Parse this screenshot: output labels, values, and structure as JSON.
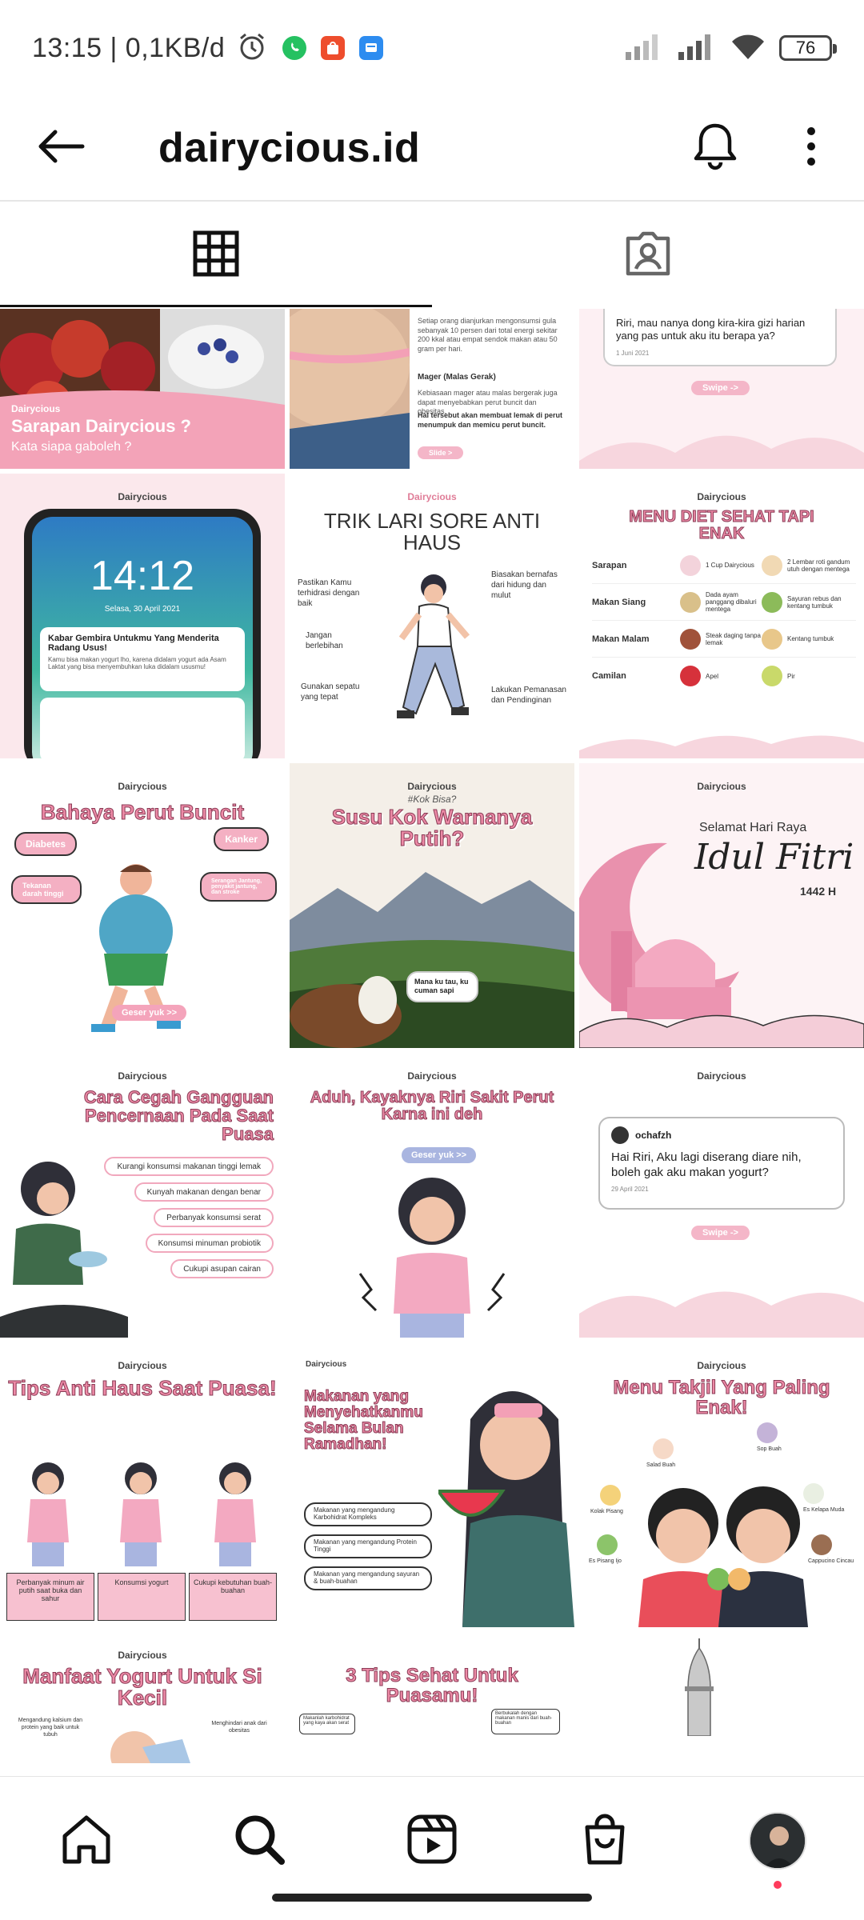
{
  "status_bar": {
    "time_speed": "13:15 | 0,1KB/d",
    "battery": "76",
    "icons": [
      "alarm-icon",
      "whatsapp-icon",
      "shopee-icon",
      "message-icon",
      "signal-icon",
      "signal-icon",
      "wifi-icon",
      "battery-icon"
    ]
  },
  "header": {
    "title": "dairycious.id",
    "icons": [
      "back-arrow-icon",
      "bell-icon",
      "more-vertical-icon"
    ]
  },
  "tabs": [
    {
      "name": "grid",
      "icon": "grid-icon",
      "active": true
    },
    {
      "name": "tagged",
      "icon": "tagged-person-icon",
      "active": false
    }
  ],
  "posts": {
    "p1": {
      "brand": "Dairycious",
      "title": "Sarapan Dairycious ?",
      "subtitle": "Kata siapa gaboleh ?"
    },
    "p2": {
      "text1": "Setiap orang dianjurkan mengonsumsi gula sebanyak 10 persen dari total energi sekitar 200 kkal atau empat sendok makan atau 50 gram per hari.",
      "heading": "Mager (Malas Gerak)",
      "text2": "Kebiasaan mager atau malas bergerak juga dapat menyebabkan perut buncit dan obesitas.",
      "text3": "Hal tersebut akan membuat lemak di perut menumpuk dan memicu perut buncit.",
      "slide": "Slide >"
    },
    "p3": {
      "question": "Riri, mau nanya dong kira-kira gizi harian yang pas untuk aku itu berapa ya?",
      "date": "1 Juni 2021",
      "swipe": "Swipe ->"
    },
    "p4": {
      "brand": "Dairycious",
      "clock": "14:12",
      "date": "Selasa, 30 April 2021",
      "notif_title": "Kabar Gembira Untukmu Yang Menderita Radang Usus!",
      "notif_body": "Kamu bisa makan yogurt lho, karena didalam yogurt ada Asam Laktat yang bisa menyembuhkan luka didalam ususmu!"
    },
    "p5": {
      "brand": "Dairycious",
      "title": "TRIK LARI SORE ANTI HAUS",
      "tips": [
        "Pastikan Kamu terhidrasi dengan baik",
        "Biasakan bernafas dari hidung dan mulut",
        "Jangan berlebihan",
        "Gunakan sepatu yang tepat",
        "Lakukan Pemanasan dan Pendinginan"
      ]
    },
    "p6": {
      "brand": "Dairycious",
      "title": "MENU DIET SEHAT TAPI ENAK",
      "rows": [
        {
          "meal": "Sarapan",
          "a": "1 Cup Dairycious",
          "b": "2 Lembar roti gandum utuh dengan mentega"
        },
        {
          "meal": "Makan Siang",
          "a": "Dada ayam panggang dibaluri mentega",
          "b": "Sayuran rebus dan kentang tumbuk"
        },
        {
          "meal": "Makan Malam",
          "a": "Steak daging tanpa lemak",
          "b": "Kentang tumbuk"
        },
        {
          "meal": "Camilan",
          "a": "Apel",
          "b": "Pir"
        }
      ]
    },
    "p7": {
      "brand": "Dairycious",
      "title": "Bahaya Perut Buncit",
      "labels": [
        "Diabetes",
        "Kanker",
        "Tekanan darah tinggi",
        "Serangan Jantung, penyakit jantung, dan stroke"
      ],
      "cta": "Geser yuk >>"
    },
    "p8": {
      "brand": "Dairycious",
      "kicker": "#Kok Bisa?",
      "title": "Susu Kok Warnanya Putih?",
      "bubble": "Mana ku tau, ku cuman sapi"
    },
    "p9": {
      "brand": "Dairycious",
      "line1": "Selamat Hari Raya",
      "script": "Idul Fitri",
      "year": "1442 H"
    },
    "p10": {
      "brand": "Dairycious",
      "title": "Cara Cegah Gangguan Pencernaan Pada Saat Puasa",
      "items": [
        "Kurangi konsumsi makanan tinggi lemak",
        "Kunyah makanan dengan benar",
        "Perbanyak konsumsi serat",
        "Konsumsi minuman probiotik",
        "Cukupi asupan cairan"
      ]
    },
    "p11": {
      "brand": "Dairycious",
      "title": "Aduh, Kayaknya Riri Sakit Perut Karna ini deh",
      "cta": "Geser yuk >>"
    },
    "p12": {
      "brand": "Dairycious",
      "user": "ochafzh",
      "message": "Hai Riri, Aku lagi diserang diare nih, boleh gak aku makan yogurt?",
      "date": "29 April 2021",
      "swipe": "Swipe ->"
    },
    "p13": {
      "brand": "Dairycious",
      "title": "Tips Anti Haus Saat Puasa!",
      "steps": [
        "Perbanyak minum air putih saat buka dan sahur",
        "Konsumsi yogurt",
        "Cukupi kebutuhan buah-buahan"
      ]
    },
    "p14": {
      "brand": "Dairycious",
      "title": "Makanan yang Menyehatkanmu Selama Bulan Ramadhan!",
      "items": [
        "Makanan yang mengandung Karbohidrat Kompleks",
        "Makanan yang mengandung Protein Tinggi",
        "Makanan yang mengandung sayuran & buah-buahan"
      ]
    },
    "p15": {
      "brand": "Dairycious",
      "title": "Menu Takjil Yang Paling Enak!",
      "foods": [
        "Salad Buah",
        "Sop Buah",
        "Kolak Pisang",
        "Es Kelapa Muda",
        "Es Pisang Ijo",
        "Cappucino Cincau"
      ]
    },
    "p16": {
      "brand": "Dairycious",
      "title": "Manfaat Yogurt Untuk Si Kecil",
      "left": "Mengandung kalsium dan protein yang baik untuk tubuh",
      "right": "Menghindari anak dari obesitas"
    },
    "p17": {
      "brand": "Dairycious",
      "title": "3 Tips Sehat Untuk Puasamu!",
      "left": "Makanlah karbohidrat yang kaya akan serat",
      "right": "Berbukalah dengan makanan manis dari buah-buahan"
    },
    "p18": {}
  },
  "bottom_nav": [
    "home-icon",
    "search-icon",
    "reels-icon",
    "shop-icon",
    "profile-avatar"
  ]
}
